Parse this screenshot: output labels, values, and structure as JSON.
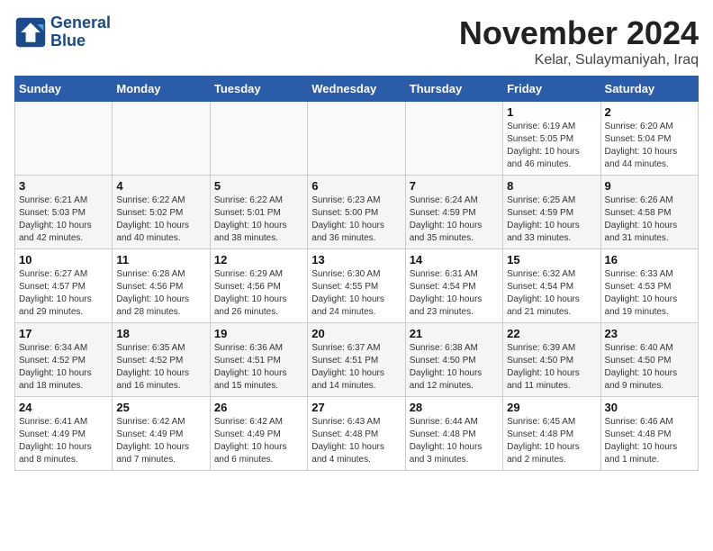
{
  "header": {
    "logo_line1": "General",
    "logo_line2": "Blue",
    "month": "November 2024",
    "location": "Kelar, Sulaymaniyah, Iraq"
  },
  "columns": [
    "Sunday",
    "Monday",
    "Tuesday",
    "Wednesday",
    "Thursday",
    "Friday",
    "Saturday"
  ],
  "weeks": [
    [
      {
        "day": "",
        "info": ""
      },
      {
        "day": "",
        "info": ""
      },
      {
        "day": "",
        "info": ""
      },
      {
        "day": "",
        "info": ""
      },
      {
        "day": "",
        "info": ""
      },
      {
        "day": "1",
        "info": "Sunrise: 6:19 AM\nSunset: 5:05 PM\nDaylight: 10 hours\nand 46 minutes."
      },
      {
        "day": "2",
        "info": "Sunrise: 6:20 AM\nSunset: 5:04 PM\nDaylight: 10 hours\nand 44 minutes."
      }
    ],
    [
      {
        "day": "3",
        "info": "Sunrise: 6:21 AM\nSunset: 5:03 PM\nDaylight: 10 hours\nand 42 minutes."
      },
      {
        "day": "4",
        "info": "Sunrise: 6:22 AM\nSunset: 5:02 PM\nDaylight: 10 hours\nand 40 minutes."
      },
      {
        "day": "5",
        "info": "Sunrise: 6:22 AM\nSunset: 5:01 PM\nDaylight: 10 hours\nand 38 minutes."
      },
      {
        "day": "6",
        "info": "Sunrise: 6:23 AM\nSunset: 5:00 PM\nDaylight: 10 hours\nand 36 minutes."
      },
      {
        "day": "7",
        "info": "Sunrise: 6:24 AM\nSunset: 4:59 PM\nDaylight: 10 hours\nand 35 minutes."
      },
      {
        "day": "8",
        "info": "Sunrise: 6:25 AM\nSunset: 4:59 PM\nDaylight: 10 hours\nand 33 minutes."
      },
      {
        "day": "9",
        "info": "Sunrise: 6:26 AM\nSunset: 4:58 PM\nDaylight: 10 hours\nand 31 minutes."
      }
    ],
    [
      {
        "day": "10",
        "info": "Sunrise: 6:27 AM\nSunset: 4:57 PM\nDaylight: 10 hours\nand 29 minutes."
      },
      {
        "day": "11",
        "info": "Sunrise: 6:28 AM\nSunset: 4:56 PM\nDaylight: 10 hours\nand 28 minutes."
      },
      {
        "day": "12",
        "info": "Sunrise: 6:29 AM\nSunset: 4:56 PM\nDaylight: 10 hours\nand 26 minutes."
      },
      {
        "day": "13",
        "info": "Sunrise: 6:30 AM\nSunset: 4:55 PM\nDaylight: 10 hours\nand 24 minutes."
      },
      {
        "day": "14",
        "info": "Sunrise: 6:31 AM\nSunset: 4:54 PM\nDaylight: 10 hours\nand 23 minutes."
      },
      {
        "day": "15",
        "info": "Sunrise: 6:32 AM\nSunset: 4:54 PM\nDaylight: 10 hours\nand 21 minutes."
      },
      {
        "day": "16",
        "info": "Sunrise: 6:33 AM\nSunset: 4:53 PM\nDaylight: 10 hours\nand 19 minutes."
      }
    ],
    [
      {
        "day": "17",
        "info": "Sunrise: 6:34 AM\nSunset: 4:52 PM\nDaylight: 10 hours\nand 18 minutes."
      },
      {
        "day": "18",
        "info": "Sunrise: 6:35 AM\nSunset: 4:52 PM\nDaylight: 10 hours\nand 16 minutes."
      },
      {
        "day": "19",
        "info": "Sunrise: 6:36 AM\nSunset: 4:51 PM\nDaylight: 10 hours\nand 15 minutes."
      },
      {
        "day": "20",
        "info": "Sunrise: 6:37 AM\nSunset: 4:51 PM\nDaylight: 10 hours\nand 14 minutes."
      },
      {
        "day": "21",
        "info": "Sunrise: 6:38 AM\nSunset: 4:50 PM\nDaylight: 10 hours\nand 12 minutes."
      },
      {
        "day": "22",
        "info": "Sunrise: 6:39 AM\nSunset: 4:50 PM\nDaylight: 10 hours\nand 11 minutes."
      },
      {
        "day": "23",
        "info": "Sunrise: 6:40 AM\nSunset: 4:50 PM\nDaylight: 10 hours\nand 9 minutes."
      }
    ],
    [
      {
        "day": "24",
        "info": "Sunrise: 6:41 AM\nSunset: 4:49 PM\nDaylight: 10 hours\nand 8 minutes."
      },
      {
        "day": "25",
        "info": "Sunrise: 6:42 AM\nSunset: 4:49 PM\nDaylight: 10 hours\nand 7 minutes."
      },
      {
        "day": "26",
        "info": "Sunrise: 6:42 AM\nSunset: 4:49 PM\nDaylight: 10 hours\nand 6 minutes."
      },
      {
        "day": "27",
        "info": "Sunrise: 6:43 AM\nSunset: 4:48 PM\nDaylight: 10 hours\nand 4 minutes."
      },
      {
        "day": "28",
        "info": "Sunrise: 6:44 AM\nSunset: 4:48 PM\nDaylight: 10 hours\nand 3 minutes."
      },
      {
        "day": "29",
        "info": "Sunrise: 6:45 AM\nSunset: 4:48 PM\nDaylight: 10 hours\nand 2 minutes."
      },
      {
        "day": "30",
        "info": "Sunrise: 6:46 AM\nSunset: 4:48 PM\nDaylight: 10 hours\nand 1 minute."
      }
    ]
  ]
}
